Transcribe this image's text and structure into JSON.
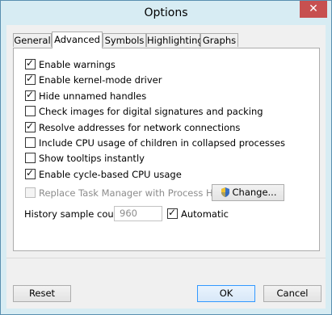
{
  "window": {
    "title": "Options",
    "close_glyph": "✕"
  },
  "tabs": [
    {
      "label": "General",
      "active": false
    },
    {
      "label": "Advanced",
      "active": true
    },
    {
      "label": "Symbols",
      "active": false
    },
    {
      "label": "Highlighting",
      "active": false
    },
    {
      "label": "Graphs",
      "active": false
    }
  ],
  "options": [
    {
      "label": "Enable warnings",
      "checked": true,
      "enabled": true
    },
    {
      "label": "Enable kernel-mode driver",
      "checked": true,
      "enabled": true
    },
    {
      "label": "Hide unnamed handles",
      "checked": true,
      "enabled": true
    },
    {
      "label": "Check images for digital signatures and packing",
      "checked": false,
      "enabled": true
    },
    {
      "label": "Resolve addresses for network connections",
      "checked": true,
      "enabled": true
    },
    {
      "label": "Include CPU usage of children in collapsed processes",
      "checked": false,
      "enabled": true
    },
    {
      "label": "Show tooltips instantly",
      "checked": false,
      "enabled": true
    },
    {
      "label": "Enable cycle-based CPU usage",
      "checked": true,
      "enabled": true
    }
  ],
  "replace_task_manager": {
    "label": "Replace Task Manager with Process Hacker",
    "checked": false,
    "enabled": false,
    "change_button": "Change..."
  },
  "history": {
    "label": "History sample count:",
    "value": "960",
    "automatic_label": "Automatic",
    "automatic_checked": true
  },
  "footer": {
    "reset": "Reset",
    "ok": "OK",
    "cancel": "Cancel"
  },
  "colors": {
    "accent": "#3399ff",
    "close": "#c75050",
    "frame": "#d7ecf3"
  },
  "icons": {
    "change": "uac-shield-icon"
  }
}
